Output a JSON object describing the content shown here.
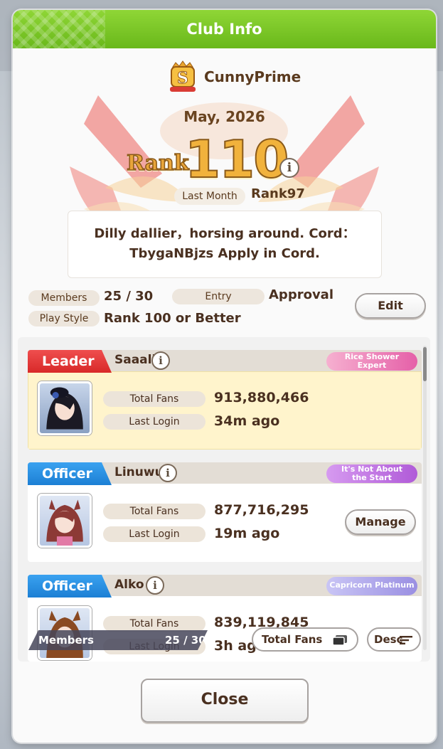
{
  "header": {
    "title": "Club Info"
  },
  "club": {
    "name": "CunnyPrime",
    "badge_letter": "S",
    "date": "May, 2026",
    "rank_label": "Rank",
    "rank_value": "110",
    "last_month_label": "Last Month",
    "last_month_value": "Rank97",
    "description_line1": "Dilly dallier，horsing around.  Cord：",
    "description_line2": "TbygaNBjzs Apply in Cord."
  },
  "summary": {
    "members_label": "Members",
    "members_value": "25 / 30",
    "entry_label": "Entry",
    "entry_value": "Approval",
    "play_style_label": "Play Style",
    "play_style_value": "Rank 100 or Better",
    "edit_button": "Edit"
  },
  "members": [
    {
      "role": "Leader",
      "name": "Saaali",
      "title": "Rice Shower Expert",
      "title_line1": "Rice Shower",
      "title_line2": "Expert",
      "total_fans_label": "Total Fans",
      "total_fans": "913,880,466",
      "last_login_label": "Last Login",
      "last_login": "34m ago"
    },
    {
      "role": "Officer",
      "name": "Linuwu",
      "title": "It's Not About the Start",
      "title_line1": "It's Not About",
      "title_line2": "the Start",
      "total_fans_label": "Total Fans",
      "total_fans": "877,716,295",
      "last_login_label": "Last Login",
      "last_login": "19m ago",
      "manage_button": "Manage"
    },
    {
      "role": "Officer",
      "name": "Alko",
      "title": "Capricorn Platinum",
      "title_line1": "Capricorn Platinum",
      "title_line2": "",
      "total_fans_label": "Total Fans",
      "total_fans": "839,119,845",
      "last_login_label": "Last Login",
      "last_login": "3h ago"
    }
  ],
  "footer": {
    "members_label": "Members",
    "members_value": "25 / 30",
    "sort_label": "Total Fans",
    "order_label": "Desc"
  },
  "close_button": "Close",
  "colors": {
    "header_green": "#6ab81d",
    "leader_red": "#d82929",
    "officer_blue": "#1c7fd4",
    "leader_card_bg": "#fff4cc"
  }
}
